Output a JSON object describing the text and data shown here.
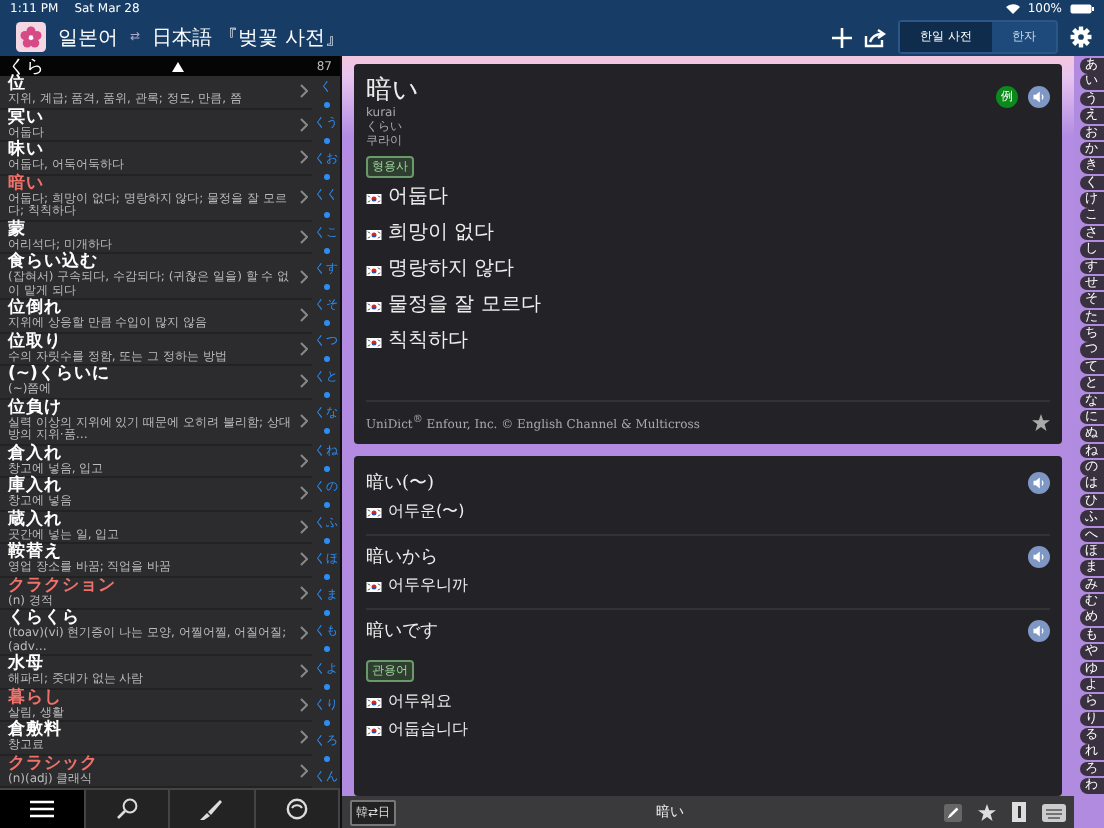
{
  "status_bar": {
    "time": "1:11 PM",
    "date": "Sat Mar 28",
    "battery": "100%"
  },
  "header": {
    "title_left": "일본어",
    "swap": "⇄",
    "title_right": "日本語 『벚꽃 사전』",
    "segments": [
      {
        "label": "한일 사전",
        "selected": true
      },
      {
        "label": "한자",
        "selected": false
      }
    ]
  },
  "search": {
    "value": "くら",
    "count": "87"
  },
  "results": [
    {
      "word": "位",
      "gloss": "지위, 계급; 품격, 품위, 관록; 정도, 만큼, 쯤",
      "highlighted": false
    },
    {
      "word": "冥い",
      "gloss": "어둡다",
      "highlighted": false
    },
    {
      "word": "昧い",
      "gloss": "어둡다, 어둑어둑하다",
      "highlighted": false
    },
    {
      "word": "暗い",
      "gloss": "어둡다; 희망이 없다; 명랑하지 않다; 물정을 잘 모르다; 칙칙하다",
      "highlighted": true
    },
    {
      "word": "蒙",
      "gloss": "어리석다; 미개하다",
      "highlighted": false
    },
    {
      "word": "食らい込む",
      "gloss": "(잡혀서) 구속되다, 수감되다; (귀찮은 일을) 할 수 없이 맡게 되다",
      "highlighted": false
    },
    {
      "word": "位倒れ",
      "gloss": "지위에 상응할 만큼 수입이 많지 않음",
      "highlighted": false
    },
    {
      "word": "位取り",
      "gloss": "수의 자릿수를 정함, 또는 그 정하는 방법",
      "highlighted": false
    },
    {
      "word": "(~)くらいに",
      "gloss": "(~)쯤에",
      "highlighted": false
    },
    {
      "word": "位負け",
      "gloss": "실력 이상의 지위에 있기 때문에 오히려 불리함; 상대방의 지위·품…",
      "highlighted": false
    },
    {
      "word": "倉入れ",
      "gloss": "창고에 넣음, 입고",
      "highlighted": false
    },
    {
      "word": "庫入れ",
      "gloss": "창고에 넣음",
      "highlighted": false
    },
    {
      "word": "蔵入れ",
      "gloss": "곳간에 넣는 일, 입고",
      "highlighted": false
    },
    {
      "word": "鞍替え",
      "gloss": "영업 장소를 바꿈; 직업을 바꿈",
      "highlighted": false
    },
    {
      "word": "クラクション",
      "gloss": "(n) 경적",
      "highlighted": true
    },
    {
      "word": "くらくら",
      "gloss": "(toav)(vi) 현기증이 나는 모양, 어찔어찔, 어질어질; (adv…",
      "highlighted": false
    },
    {
      "word": "水母",
      "gloss": "해파리; 줏대가 없는 사람",
      "highlighted": false
    },
    {
      "word": "暮らし",
      "gloss": "살림, 생활",
      "highlighted": true
    },
    {
      "word": "倉敷料",
      "gloss": "창고료",
      "highlighted": false
    },
    {
      "word": "クラシック",
      "gloss": "(n)(adj) 클래식",
      "highlighted": true
    }
  ],
  "section_index": [
    "く",
    "くう",
    "くお",
    "くく",
    "くこ",
    "くす",
    "くそ",
    "くつ",
    "くと",
    "くな",
    "くね",
    "くの",
    "くふ",
    "くほ",
    "くま",
    "くも",
    "くよ",
    "くり",
    "くろ",
    "くん"
  ],
  "bottom_tabs": [
    {
      "kind": "list",
      "selected": true
    },
    {
      "kind": "search",
      "selected": false
    },
    {
      "kind": "brush",
      "selected": false
    },
    {
      "kind": "history",
      "selected": false
    }
  ],
  "entry": {
    "headword": "暗い",
    "romaji": "kurai",
    "kana": "くらい",
    "hangul": "쿠라이",
    "example_badge": "例",
    "part_of_speech": "형용사",
    "meanings": [
      "어둡다",
      "희망이 없다",
      "명랑하지 않다",
      "물정을 잘 모르다",
      "칙칙하다"
    ],
    "credit": "UniDict$^{®}$ Enfour, Inc. © English Channel & Multicross"
  },
  "phrases": [
    {
      "phrase": "暗い(〜)",
      "meanings": [
        "어두운(〜)"
      ]
    },
    {
      "phrase": "暗いから",
      "meanings": [
        "어두우니까"
      ]
    },
    {
      "phrase": "暗いです",
      "tag": "관용어",
      "meanings": [
        "어두워요",
        "어둡습니다"
      ]
    }
  ],
  "bottom_bar": {
    "direction": "韓⇄日",
    "query": "暗い"
  },
  "kana_index": [
    "あ",
    "い",
    "う",
    "え",
    "お",
    "か",
    "き",
    "く",
    "け",
    "こ",
    "さ",
    "し",
    "す",
    "せ",
    "そ",
    "た",
    "ち",
    "つ",
    "て",
    "と",
    "な",
    "に",
    "ぬ",
    "ね",
    "の",
    "は",
    "ひ",
    "ふ",
    "へ",
    "ほ",
    "ま",
    "み",
    "む",
    "め",
    "も",
    "や",
    "ゆ",
    "よ",
    "ら",
    "り",
    "る",
    "れ",
    "ろ",
    "わ"
  ]
}
